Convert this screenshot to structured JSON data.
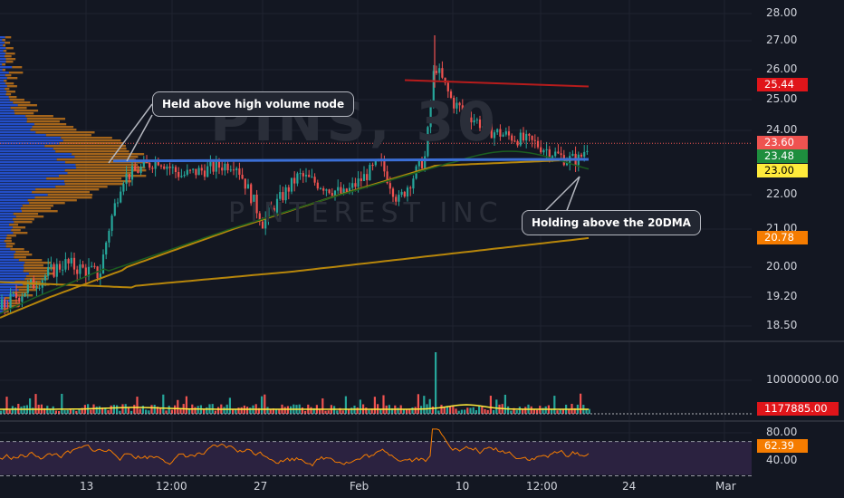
{
  "watermark": {
    "title": "PINS, 30",
    "subtitle": "PINTEREST INC"
  },
  "annotations": {
    "callout1": "Held above high volume node",
    "callout2": "Holding above the 20DMA"
  },
  "colors": {
    "background": "#131722",
    "grid": "#1f2330",
    "up": "#26a69a",
    "down": "#ef5350",
    "ma_short": "#1b5e20",
    "ma_long": "#b7860b",
    "support_line": "#3b6fd6",
    "volume_profile_blue": "#2962ff",
    "volume_profile_orange": "#d47f1a",
    "rsi_line": "#f57c00",
    "rsi_band": "#2b2240"
  },
  "chart_data": [
    {
      "type": "candlestick",
      "title": "",
      "ylim": [
        18.1,
        28.3
      ],
      "y_ticks": [
        "28.00",
        "27.00",
        "26.00",
        "25.00",
        "24.00",
        "22.00",
        "21.00",
        "20.00",
        "19.20",
        "18.50"
      ],
      "x_ticks": [
        "13",
        "12:00",
        "27",
        "Feb",
        "10",
        "12:00",
        "24",
        "Mar"
      ],
      "price_tags": [
        {
          "value": "25.44",
          "color": "#e0151a",
          "text_color": "#ffffff"
        },
        {
          "value": "23.60",
          "color": "#ef5350",
          "text_color": "#ffffff"
        },
        {
          "value": "23.48",
          "color": "#1e8e3e",
          "text_color": "#ffffff"
        },
        {
          "value": "23.00",
          "color": "#ffeb3b",
          "text_color": "#000000"
        },
        {
          "value": "20.78",
          "color": "#f57c00",
          "text_color": "#ffffff"
        }
      ],
      "key_levels": {
        "support": 23.05,
        "last": 23.6,
        "previous_high_line": 25.44
      }
    },
    {
      "type": "bar",
      "name": "volume",
      "y_ticks": [
        "10000000.00"
      ],
      "price_tags": [
        {
          "value": "1177885.00",
          "color": "#e0151a",
          "text_color": "#ffffff"
        }
      ]
    },
    {
      "type": "line",
      "name": "rsi",
      "ylim": [
        30,
        95
      ],
      "y_ticks": [
        "80.00",
        "40.00"
      ],
      "band": [
        30,
        70
      ],
      "price_tags": [
        {
          "value": "62.39",
          "color": "#f57c00",
          "text_color": "#ffffff"
        }
      ]
    }
  ]
}
